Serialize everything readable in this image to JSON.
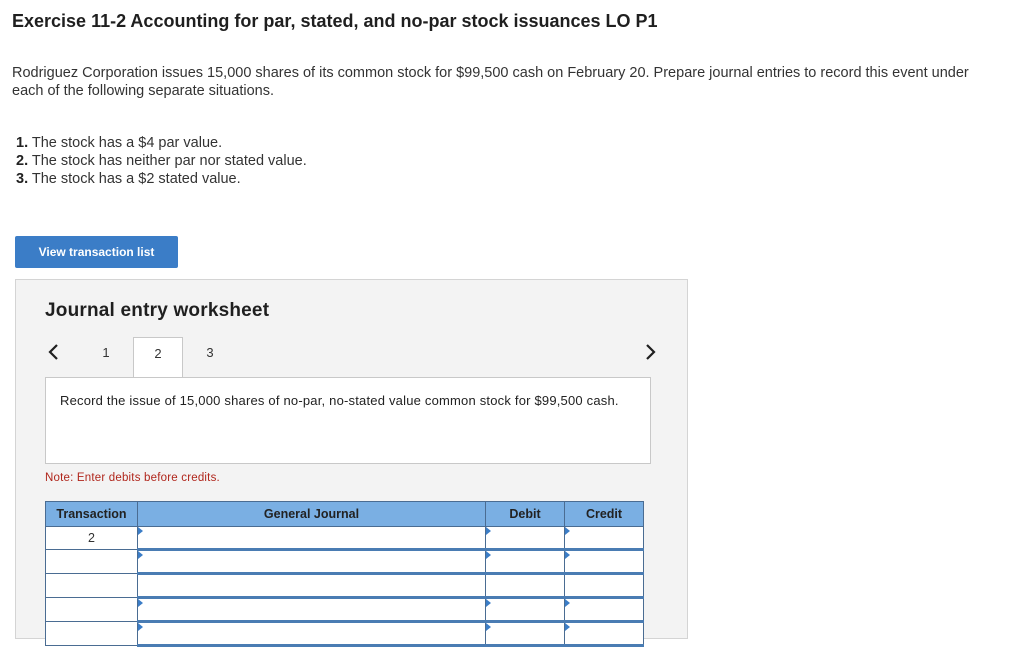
{
  "header": {
    "title": "Exercise 11-2 Accounting for par, stated, and no-par stock issuances LO P1"
  },
  "intro": {
    "text": "Rodriguez Corporation issues 15,000 shares of its common stock for $99,500 cash on February 20. Prepare journal entries to record this event under each of the following separate situations."
  },
  "requirements": [
    {
      "num": "1.",
      "text": "The stock has a $4 par value."
    },
    {
      "num": "2.",
      "text": "The stock has neither par nor stated value."
    },
    {
      "num": "3.",
      "text": "The stock has a $2 stated value."
    }
  ],
  "view_button": {
    "label": "View transaction list"
  },
  "worksheet": {
    "title": "Journal entry worksheet",
    "tabs": [
      "1",
      "2",
      "3"
    ],
    "active_tab": "2",
    "prompt": "Record the issue of 15,000 shares of no-par, no-stated value common stock for $99,500 cash.",
    "note": "Note: Enter debits before credits.",
    "table": {
      "columns": [
        "Transaction",
        "General Journal",
        "Debit",
        "Credit"
      ],
      "rows": [
        {
          "transaction": "2",
          "account": "",
          "debit": "",
          "credit": ""
        },
        {
          "transaction": "",
          "account": "",
          "debit": "",
          "credit": ""
        },
        {
          "transaction": "",
          "account": "",
          "debit": "",
          "credit": ""
        },
        {
          "transaction": "",
          "account": "",
          "debit": "",
          "credit": ""
        },
        {
          "transaction": "",
          "account": "",
          "debit": "",
          "credit": ""
        }
      ]
    }
  }
}
